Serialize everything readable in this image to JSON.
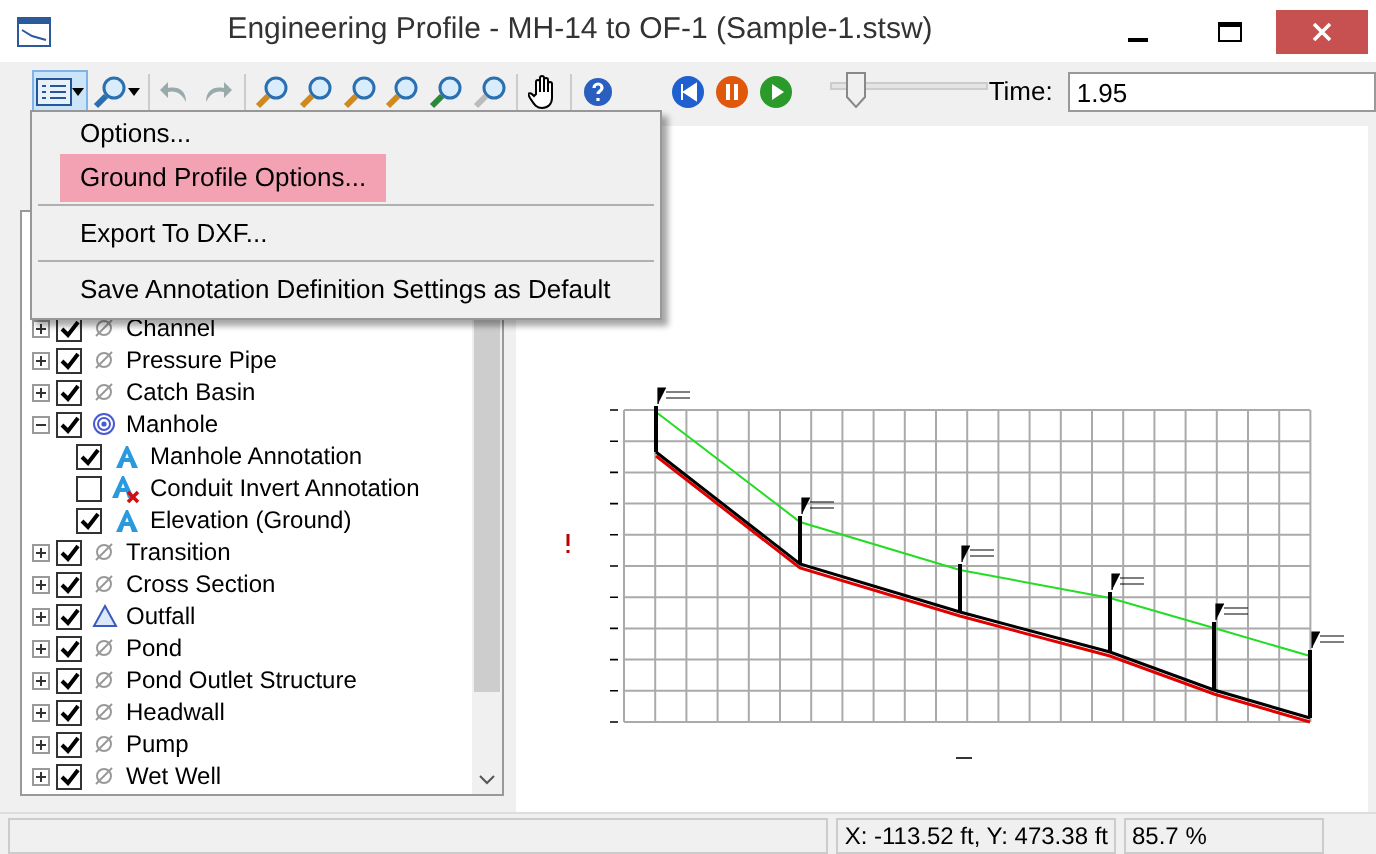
{
  "window": {
    "title": "Engineering Profile - MH-14 to OF-1 (Sample-1.stsw)"
  },
  "playback": {
    "level": 0.12,
    "time_label": "Time:",
    "time_value": "1.95"
  },
  "menu": [
    {
      "label": "Options...",
      "selected": false
    },
    {
      "label": "Ground Profile Options...",
      "selected": true
    },
    {
      "label": "Export To DXF...",
      "selected": false
    },
    {
      "label": "Save Annotation Definition Settings as Default",
      "selected": false
    }
  ],
  "tree": [
    {
      "label": "Channel",
      "kind": "none",
      "checked": true,
      "expanded": false
    },
    {
      "label": "Pressure Pipe",
      "kind": "none",
      "checked": true,
      "expanded": false
    },
    {
      "label": "Catch Basin",
      "kind": "none",
      "checked": true,
      "expanded": false
    },
    {
      "label": "Manhole",
      "kind": "manhole",
      "checked": true,
      "expanded": true,
      "children": [
        {
          "label": "Manhole Annotation",
          "kind": "annotation",
          "checked": true
        },
        {
          "label": "Conduit Invert Annotation",
          "kind": "annotation-off",
          "checked": false
        },
        {
          "label": "Elevation (Ground)",
          "kind": "annotation",
          "checked": true
        }
      ]
    },
    {
      "label": "Transition",
      "kind": "none",
      "checked": true,
      "expanded": false
    },
    {
      "label": "Cross Section",
      "kind": "none",
      "checked": true,
      "expanded": false
    },
    {
      "label": "Outfall",
      "kind": "outfall",
      "checked": true,
      "expanded": false
    },
    {
      "label": "Pond",
      "kind": "none",
      "checked": true,
      "expanded": false
    },
    {
      "label": "Pond Outlet Structure",
      "kind": "none",
      "checked": true,
      "expanded": false
    },
    {
      "label": "Headwall",
      "kind": "none",
      "checked": true,
      "expanded": false
    },
    {
      "label": "Pump",
      "kind": "none",
      "checked": true,
      "expanded": false
    },
    {
      "label": "Wet Well",
      "kind": "none",
      "checked": true,
      "expanded": false
    }
  ],
  "status_bar": {
    "coordinates": "X: -113.52 ft, Y:  473.38 ft",
    "zoom": "85.7 %"
  }
}
